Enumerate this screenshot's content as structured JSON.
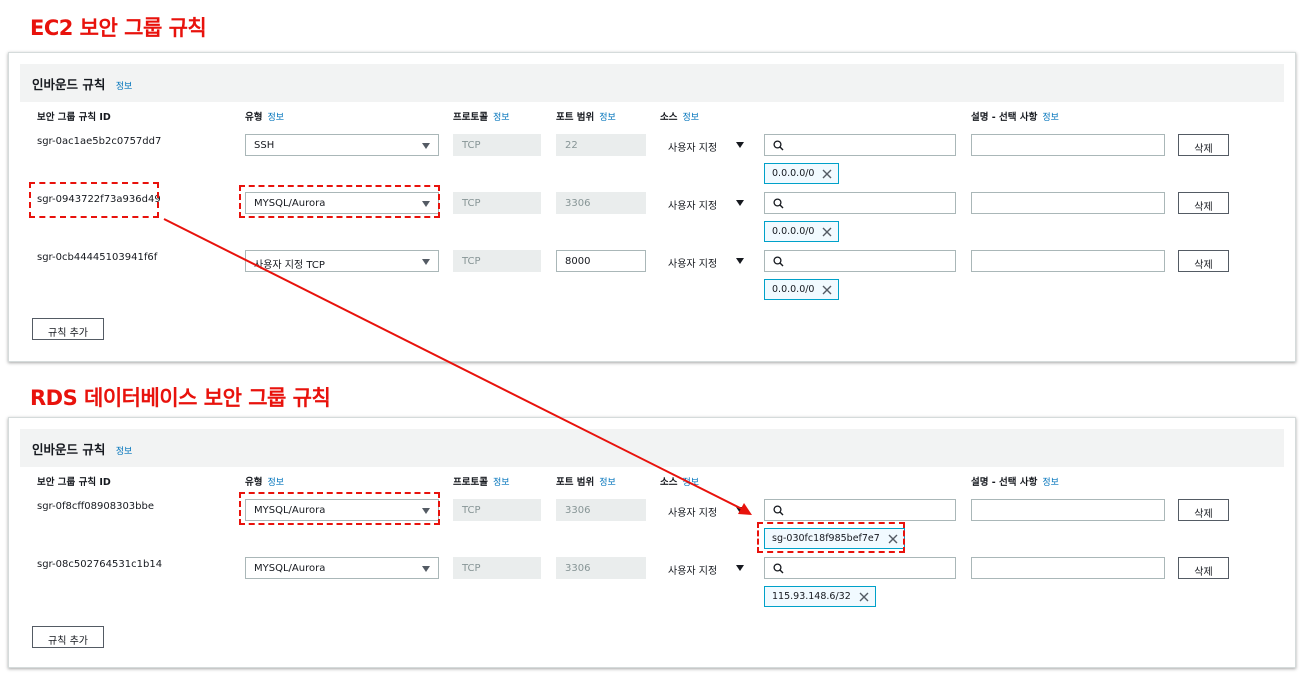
{
  "colors": {
    "highlight": "#e8120c",
    "info_link": "#0073bb",
    "token_border": "#00a1c9"
  },
  "columns": {
    "rule_id": "보안 그룹 규칙 ID",
    "type": "유형",
    "protocol": "프로토콜",
    "port": "포트 범위",
    "source": "소스",
    "desc": "설명 - 선택 사항",
    "info": "정보"
  },
  "ec2": {
    "title": "EC2 보안 그룹 규칙",
    "panel_title": "인바운드 규칙",
    "info": "정보",
    "add_rule": "규칙 추가",
    "rows": [
      {
        "id": "sgr-0ac1ae5b2c0757dd7",
        "type": "SSH",
        "protocol": "TCP",
        "port": "22",
        "source_type": "사용자 지정",
        "token": "0.0.0.0/0",
        "delete": "삭제"
      },
      {
        "id": "sgr-0943722f73a936d49",
        "type": "MYSQL/Aurora",
        "protocol": "TCP",
        "port": "3306",
        "source_type": "사용자 지정",
        "token": "0.0.0.0/0",
        "delete": "삭제"
      },
      {
        "id": "sgr-0cb44445103941f6f",
        "type": "사용자 지정 TCP",
        "protocol": "TCP",
        "port": "8000",
        "source_type": "사용자 지정",
        "token": "0.0.0.0/0",
        "delete": "삭제"
      }
    ]
  },
  "rds": {
    "title": "RDS 데이터베이스 보안 그룹 규칙",
    "panel_title": "인바운드 규칙",
    "info": "정보",
    "add_rule": "규칙 추가",
    "rows": [
      {
        "id": "sgr-0f8cff08908303bbe",
        "type": "MYSQL/Aurora",
        "protocol": "TCP",
        "port": "3306",
        "source_type": "사용자 지정",
        "token": "sg-030fc18f985bef7e7",
        "delete": "삭제"
      },
      {
        "id": "sgr-08c502764531c1b14",
        "type": "MYSQL/Aurora",
        "protocol": "TCP",
        "port": "3306",
        "source_type": "사용자 지정",
        "token": "115.93.148.6/32",
        "delete": "삭제"
      }
    ]
  }
}
